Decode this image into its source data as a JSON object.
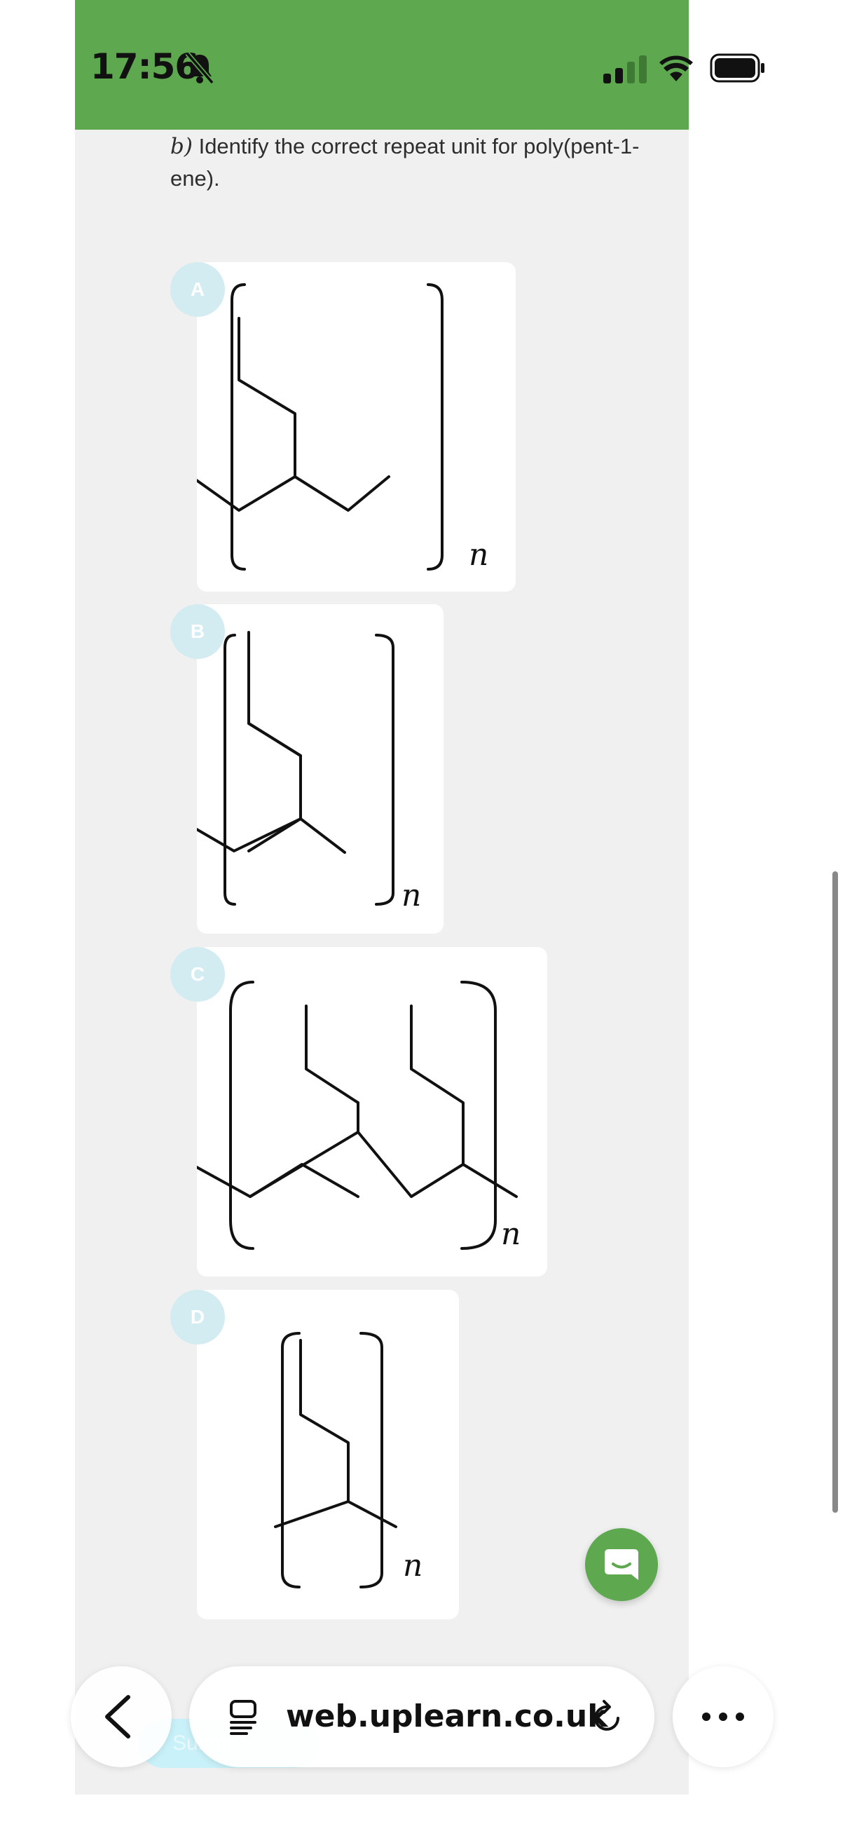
{
  "status_bar": {
    "time": "17:56",
    "background": "#5ea84f",
    "icons": [
      "bell-slash-icon",
      "cellular-signal-icon",
      "wifi-icon",
      "battery-icon"
    ]
  },
  "question": {
    "letter": "b)",
    "text": "Identify the correct repeat unit for poly(pent-1-ene)."
  },
  "options": [
    {
      "label": "A",
      "subscript": "n"
    },
    {
      "label": "B",
      "subscript": "n"
    },
    {
      "label": "C",
      "subscript": "n"
    },
    {
      "label": "D",
      "subscript": "n"
    }
  ],
  "submit_label": "Submit",
  "browser": {
    "url": "web.uplearn.co.uk",
    "icons": [
      "back-chevron-icon",
      "tabs-icon",
      "reload-icon",
      "more-dots-icon"
    ]
  },
  "colors": {
    "accent_green": "#5ea84f",
    "badge_bg": "#d3ecf1",
    "submit_bg": "#c9f1f9",
    "page_bg": "#f0f0f0"
  }
}
